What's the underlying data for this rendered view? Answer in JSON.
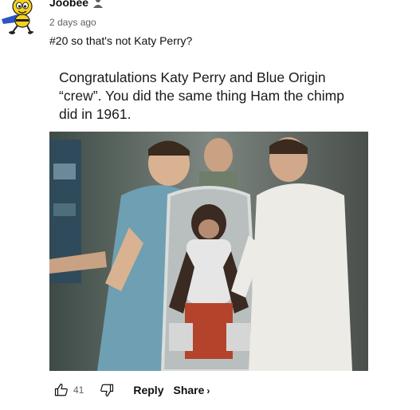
{
  "comment": {
    "author": "Joobee",
    "timestamp": "2 days ago",
    "text": "#20 so that's not Katy Perry?",
    "attachment": {
      "caption": "Congratulations Katy Perry and Blue Origin “crew”. You did the same thing Ham the chimp did in 1961."
    },
    "actions": {
      "like_count": "41",
      "reply_label": "Reply",
      "share_label": "Share",
      "icons": [
        "thumb-up-icon",
        "thumb-down-icon",
        "chevron-right-icon"
      ]
    }
  },
  "colors": {
    "text_primary": "#0f0f0f",
    "text_secondary": "#606060",
    "avatar_yellow": "#f7d21b",
    "avatar_blue": "#2a55c8"
  }
}
